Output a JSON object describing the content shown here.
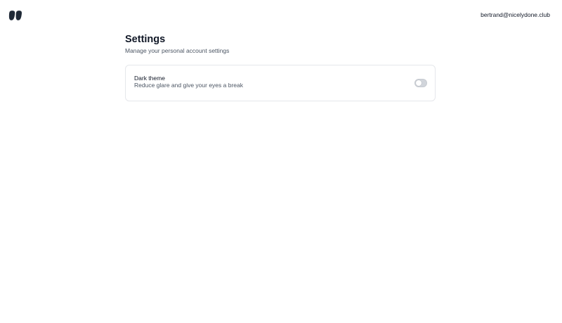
{
  "header": {
    "logo_icon": "brand-logo-icon",
    "user_email": "bertrand@nicelydone.club"
  },
  "settings": {
    "title": "Settings",
    "subtitle": "Manage your personal account settings",
    "items": [
      {
        "label": "Dark theme",
        "description": "Reduce glare and give your eyes a break",
        "enabled": false
      }
    ]
  },
  "colors": {
    "text_primary": "#111827",
    "text_secondary": "#4b5563",
    "card_border": "#e5e7eb",
    "toggle_off": "#d1d5db"
  }
}
